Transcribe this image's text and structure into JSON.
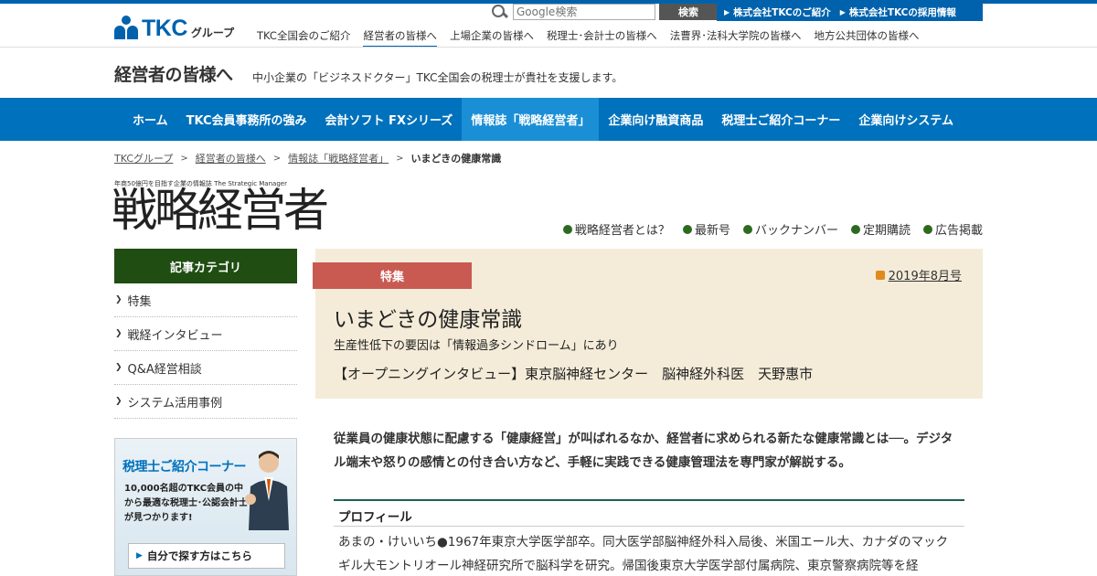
{
  "header": {
    "logo_text": "TKC",
    "logo_group": "グループ",
    "search_placeholder": "Google検索",
    "search_button": "検索",
    "corp_links": [
      "株式会社TKCのご紹介",
      "株式会社TKCの採用情報"
    ],
    "topnav": [
      {
        "label": "TKC全国会のご紹介",
        "active": false
      },
      {
        "label": "経営者の皆様へ",
        "active": true
      },
      {
        "label": "上場企業の皆様へ",
        "active": false
      },
      {
        "label": "税理士･会計士の皆様へ",
        "active": false
      },
      {
        "label": "法曹界･法科大学院の皆様へ",
        "active": false
      },
      {
        "label": "地方公共団体の皆様へ",
        "active": false
      }
    ]
  },
  "section": {
    "title": "経営者の皆様へ",
    "subtitle": "中小企業の「ビジネスドクター」TKC全国会の税理士が貴社を支援します。"
  },
  "mainnav": [
    {
      "label": "ホーム",
      "active": false
    },
    {
      "label": "TKC会員事務所の強み",
      "active": false
    },
    {
      "label": "会計ソフト FXシリーズ",
      "active": false
    },
    {
      "label": "情報誌「戦略経営者」",
      "active": true
    },
    {
      "label": "企業向け融資商品",
      "active": false
    },
    {
      "label": "税理士ご紹介コーナー",
      "active": false
    },
    {
      "label": "企業向けシステム",
      "active": false
    }
  ],
  "breadcrumb": {
    "links": [
      "TKCグループ",
      "経営者の皆様へ",
      "情報誌「戦略経営者」"
    ],
    "separator": ">",
    "current": "いまどきの健康常識"
  },
  "magazine": {
    "tagline": "年商50億円を目指す企業の情報誌",
    "tagline_en": "The Strategic Manager",
    "title": "戦略経営者",
    "links": [
      "戦略経営者とは？",
      "最新号",
      "バックナンバー",
      "定期購読",
      "広告掲載"
    ]
  },
  "sidebar": {
    "category_heading": "記事カテゴリ",
    "categories": [
      "特集",
      "戦経インタビュー",
      "Q&A経営相談",
      "システム活用事例"
    ],
    "promo": {
      "title": "税理士ご紹介コーナー",
      "text": "10,000名超のTKC会員の中から最適な税理士･公認会計士が見つかります!",
      "button": "自分で探す方はこちら"
    }
  },
  "article": {
    "tag": "特集",
    "issue": "2019年8月号",
    "title": "いまどきの健康常識",
    "subtitle": "生産性低下の要因は「情報過多シンドローム」にあり",
    "interview": "【オープニングインタビュー】東京脳神経センター　脳神経外科医　天野惠市",
    "lead": "従業員の健康状態に配慮する「健康経営」が叫ばれるなか、経営者に求められる新たな健康常識とは──。デジタル端末や怒りの感情との付き合い方など、手軽に実践できる健康管理法を専門家が解説する。",
    "profile_heading": "プロフィール",
    "profile_text": "あまの・けいいち●1967年東京大学医学部卒。同大医学部脳神経外科入局後、米国エール大、カナダのマックギル大モントリオール神経研究所で脳科学を研究。帰国後東京大学医学部付属病院、東京警察病院等を経"
  },
  "colors": {
    "brand_blue": "#0062ad",
    "nav_blue": "#0071bc",
    "nav_active": "#1a8fd6",
    "sidebar_green": "#1f4d12",
    "tag_red": "#c85a52",
    "article_bg": "#f4ecd9"
  }
}
